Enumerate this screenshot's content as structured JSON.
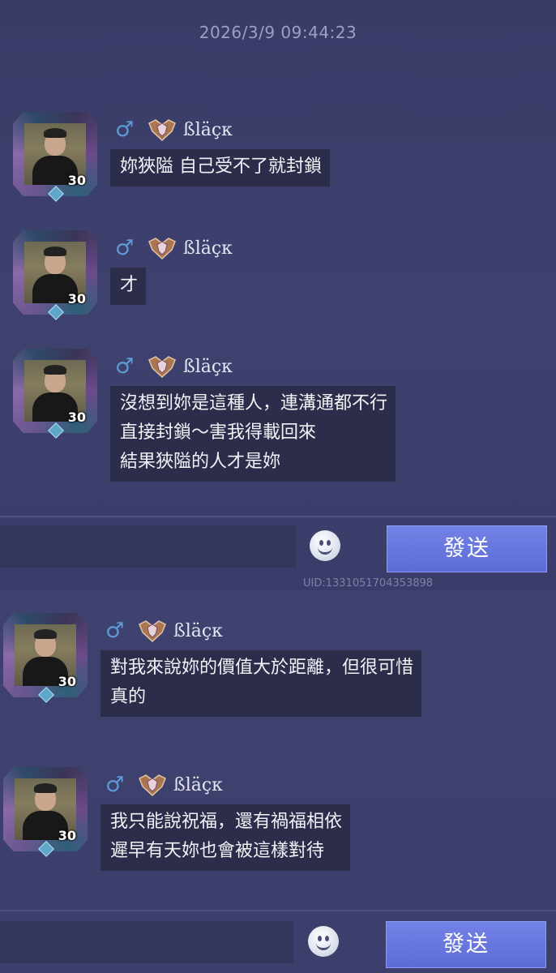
{
  "timestamp": "2026/3/9  09:44:23",
  "sender": {
    "name": "ßläçκ",
    "gender_icon": "male-icon",
    "level": "30"
  },
  "messages_top": [
    {
      "text": "妳狹隘 自己受不了就封鎖"
    },
    {
      "text": "才"
    },
    {
      "text": "沒想到妳是這種人，連溝通都不行\n直接封鎖～害我得載回來\n結果狹隘的人才是妳"
    }
  ],
  "messages_bottom": [
    {
      "text": "對我來說妳的價值大於距離，但很可惜\n真的"
    },
    {
      "text": "我只能說祝福，還有禍福相依\n遲早有天妳也會被這樣對待"
    }
  ],
  "send_label": "發送",
  "uid": "UID:1331051704353898",
  "colors": {
    "bubble": "#2b2d4a",
    "send_button": "#6474dc",
    "male_icon": "#5e9ad6"
  }
}
